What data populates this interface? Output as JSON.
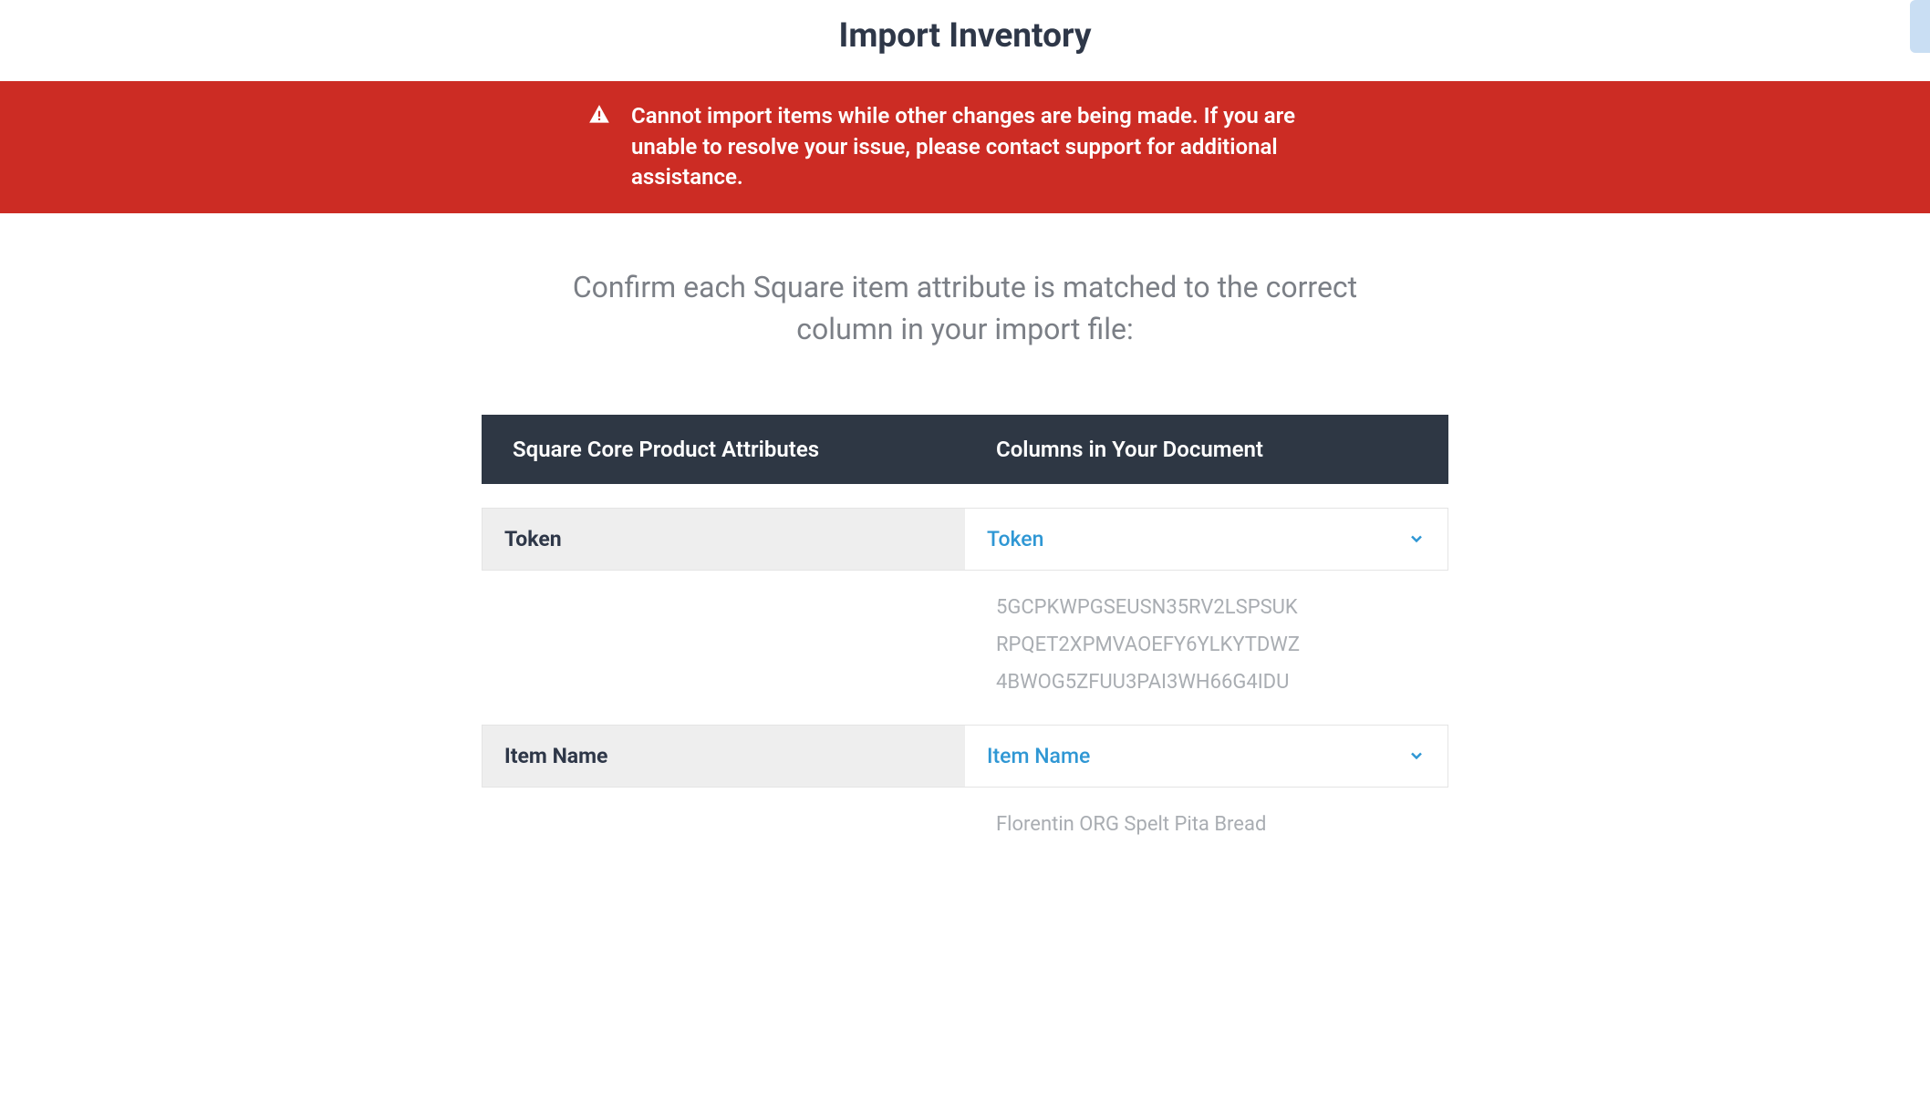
{
  "header": {
    "title": "Import Inventory"
  },
  "alert": {
    "message": "Cannot import items while other changes are being made. If you are unable to resolve your issue, please contact support for additional assistance."
  },
  "instruction": "Confirm each Square item attribute is matched to the correct column in your import file:",
  "table_headers": {
    "left": "Square Core Product Attributes",
    "right": "Columns in Your Document"
  },
  "attributes": [
    {
      "label": "Token",
      "selected": "Token",
      "samples": [
        "5GCPKWPGSEUSN35RV2LSPSUK",
        "RPQET2XPMVAOEFY6YLKYTDWZ",
        "4BWOG5ZFUU3PAI3WH66G4IDU"
      ]
    },
    {
      "label": "Item Name",
      "selected": "Item Name",
      "samples": [
        "Florentin ORG Spelt Pita Bread"
      ]
    }
  ]
}
